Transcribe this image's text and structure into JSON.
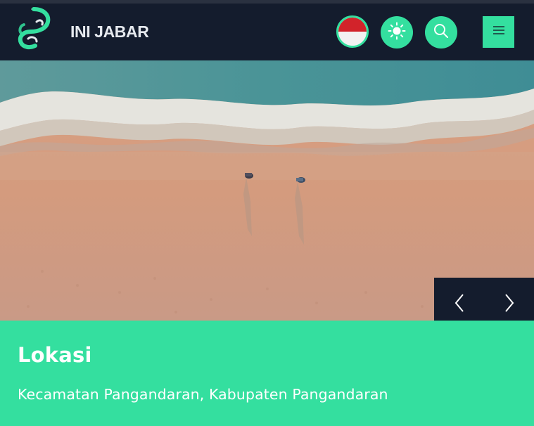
{
  "header": {
    "brand": "INI JABAR",
    "logo_icon": "ini-jabar-logo-icon",
    "language_flag": "indonesia-flag-icon",
    "theme_icon": "sun-icon",
    "search_icon": "search-icon",
    "menu_icon": "hamburger-menu-icon"
  },
  "hero": {
    "image": "aerial beach with two walkers",
    "prev_icon": "chevron-left-icon",
    "next_icon": "chevron-right-icon"
  },
  "info": {
    "title": "Lokasi",
    "text": "Kecamatan Pangandaran, Kabupaten Pangandaran"
  },
  "colors": {
    "accent": "#34df9f",
    "dark": "#141c2d",
    "flag_red": "#d2232a"
  }
}
